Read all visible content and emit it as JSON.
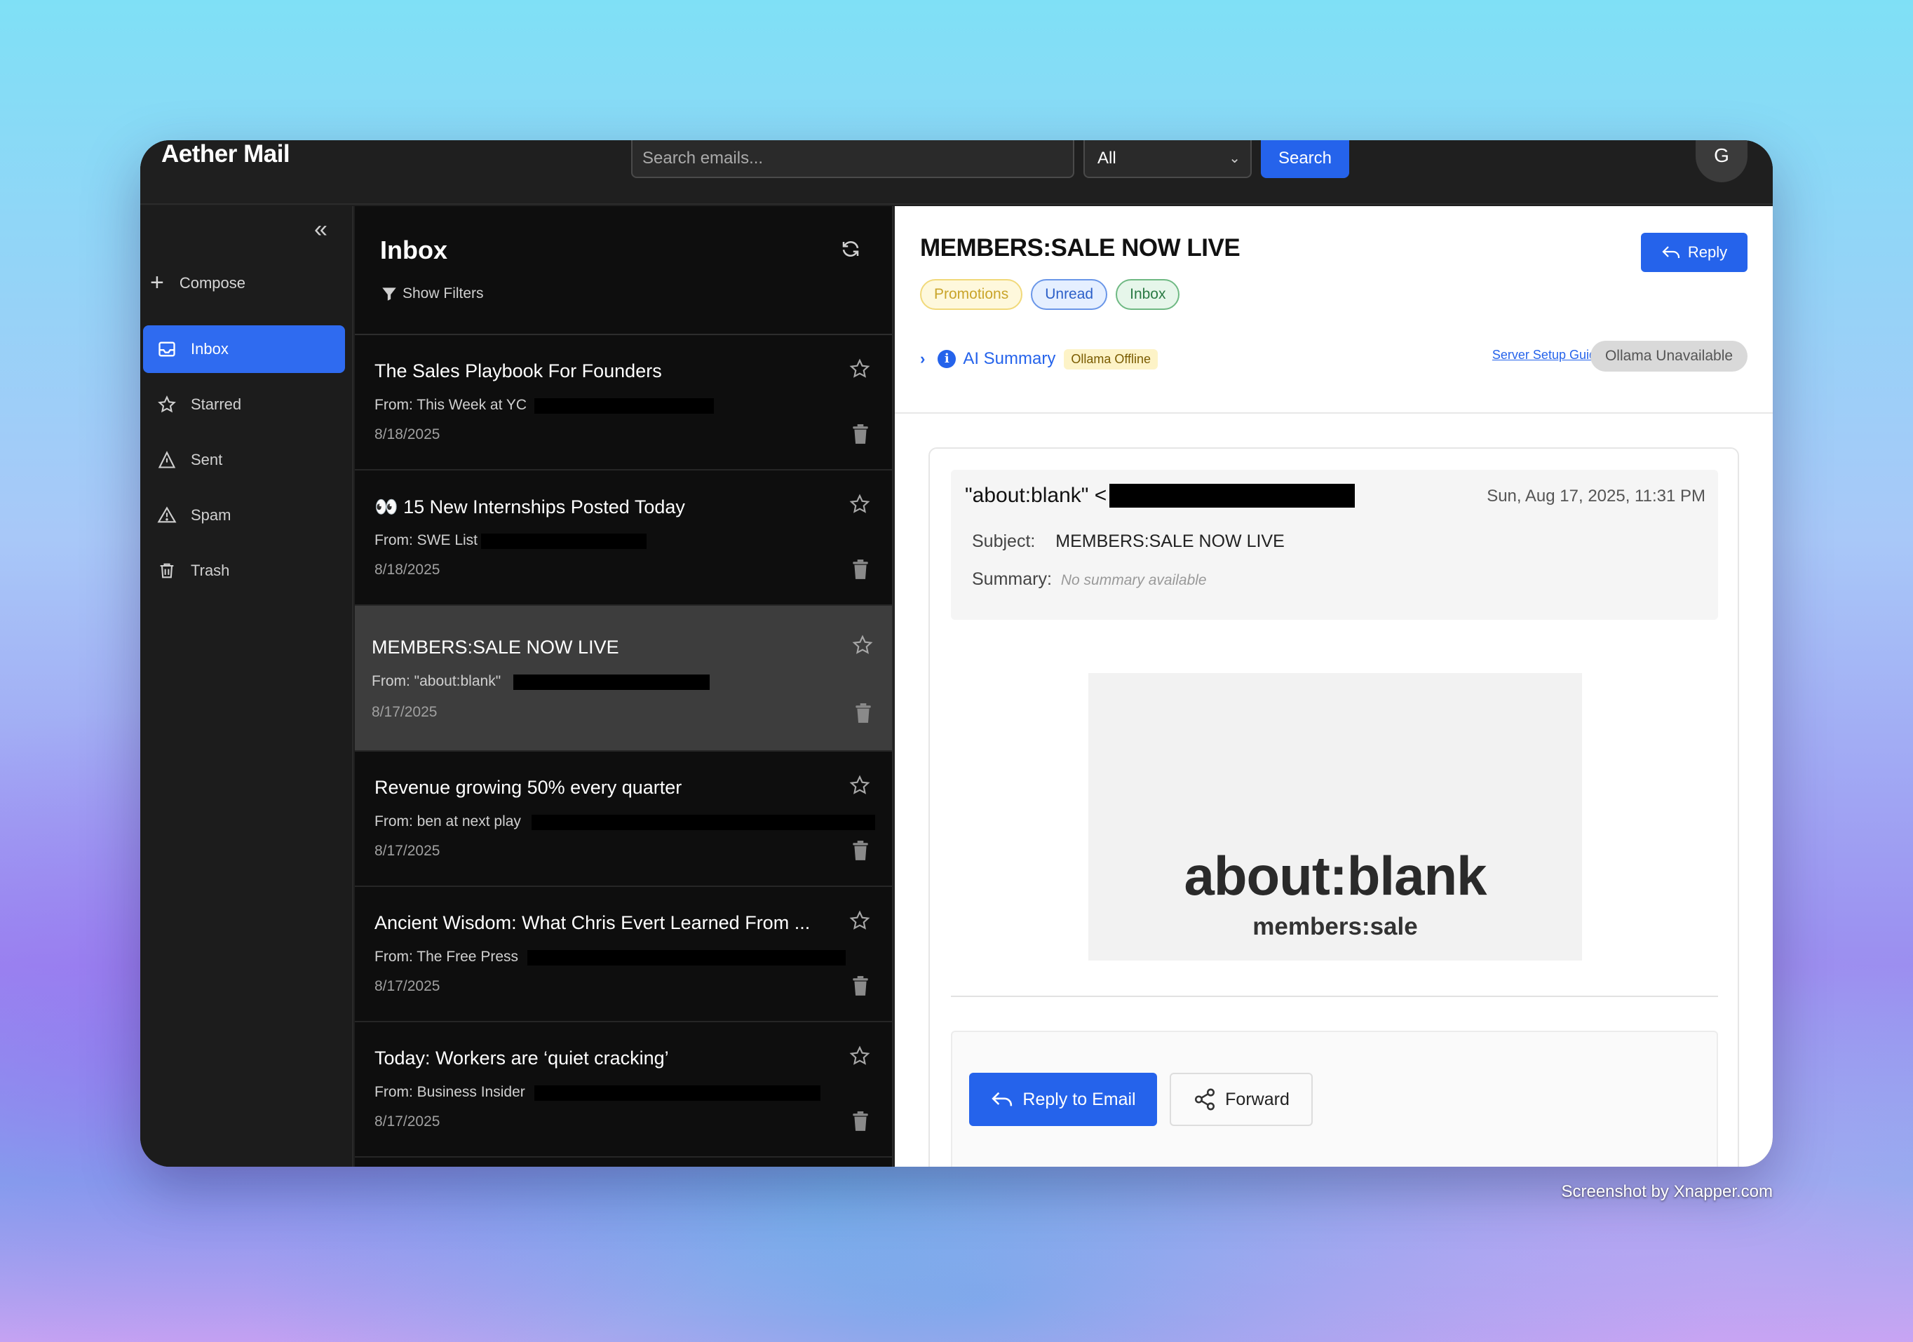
{
  "app": {
    "title": "Aether Mail",
    "avatar_initial": "G"
  },
  "search": {
    "placeholder": "Search emails...",
    "scope": "All",
    "button": "Search"
  },
  "sidebar": {
    "compose": "Compose",
    "items": [
      {
        "label": "Inbox",
        "icon": "inbox-icon",
        "active": true
      },
      {
        "label": "Starred",
        "icon": "star-icon"
      },
      {
        "label": "Sent",
        "icon": "send-icon"
      },
      {
        "label": "Spam",
        "icon": "warning-icon"
      },
      {
        "label": "Trash",
        "icon": "trash-icon"
      }
    ]
  },
  "list": {
    "title": "Inbox",
    "filters": "Show Filters",
    "emails": [
      {
        "subject": "The Sales Playbook For Founders",
        "from": "From: This Week at YC",
        "date": "8/18/2025"
      },
      {
        "subject": "👀 15 New Internships Posted Today",
        "from": "From: SWE List",
        "date": "8/18/2025"
      },
      {
        "subject": "MEMBERS:SALE NOW LIVE",
        "from": "From: \"about:blank\"",
        "date": "8/17/2025",
        "selected": true
      },
      {
        "subject": "Revenue growing 50% every quarter",
        "from": "From: ben at next play",
        "date": "8/17/2025"
      },
      {
        "subject": "Ancient Wisdom: What Chris Evert Learned From ...",
        "from": "From: The Free Press",
        "date": "8/17/2025"
      },
      {
        "subject": "Today: Workers are ‘quiet cracking’",
        "from": "From: Business Insider",
        "date": "8/17/2025"
      }
    ]
  },
  "detail": {
    "title": "MEMBERS:SALE NOW LIVE",
    "reply": "Reply",
    "tags": [
      "Promotions",
      "Unread",
      "Inbox"
    ],
    "ai_summary": "AI Summary",
    "ollama_status": "Ollama Offline",
    "setup_link": "Server Setup Guide",
    "ollama_button": "Ollama Unavailable",
    "sender": "\"about:blank\" <",
    "sent_date": "Sun, Aug 17, 2025, 11:31 PM",
    "subject_label": "Subject:",
    "subject_value": "MEMBERS:SALE NOW LIVE",
    "summary_label": "Summary:",
    "summary_value": "No summary available",
    "preview_big": "about:blank",
    "preview_small": "members:sale",
    "reply_to_email": "Reply to Email",
    "forward": "Forward"
  },
  "credit": "Screenshot by Xnapper.com"
}
